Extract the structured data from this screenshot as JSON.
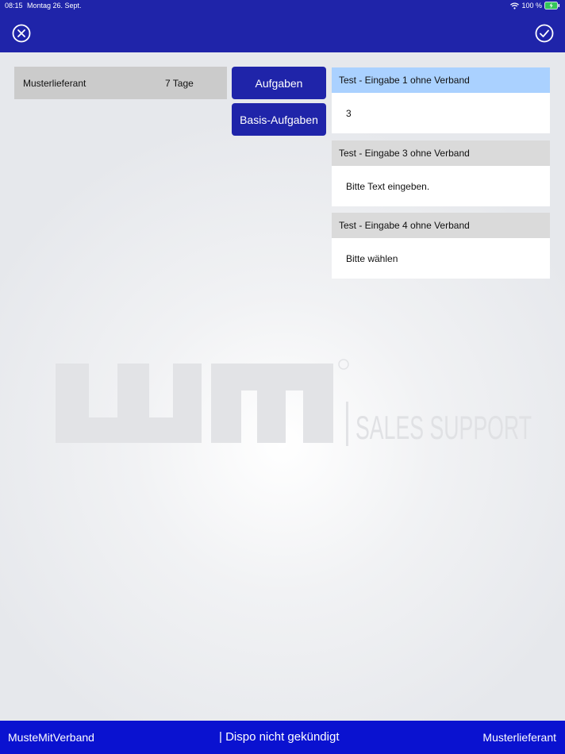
{
  "status_bar": {
    "time": "08:15",
    "date": "Montag 26. Sept.",
    "battery": "100 %"
  },
  "supplier": {
    "name": "Musterlieferant",
    "days": "7 Tage"
  },
  "buttons": {
    "tasks": "Aufgaben",
    "basis_tasks": "Basis-Aufgaben"
  },
  "cards": [
    {
      "title": "Test - Eingabe 1 ohne Verband",
      "value": "3"
    },
    {
      "title": "Test - Eingabe 3 ohne Verband",
      "value": "Bitte Text eingeben."
    },
    {
      "title": "Test - Eingabe 4 ohne Verband",
      "value": "Bitte wählen"
    }
  ],
  "watermark": {
    "brand": "wm",
    "tagline": "SALES SUPPORT"
  },
  "bottom_bar": {
    "left": "MusteMitVerband",
    "center": "| Dispo nicht gekündigt",
    "right": "Musterlieferant"
  },
  "colors": {
    "header": "#1f24a9",
    "footer": "#0a12d0",
    "active_card": "#aad1ff"
  },
  "icons": {
    "close": "close-circle-icon",
    "confirm": "check-circle-icon",
    "wifi": "wifi-icon",
    "battery": "battery-charging-icon"
  }
}
